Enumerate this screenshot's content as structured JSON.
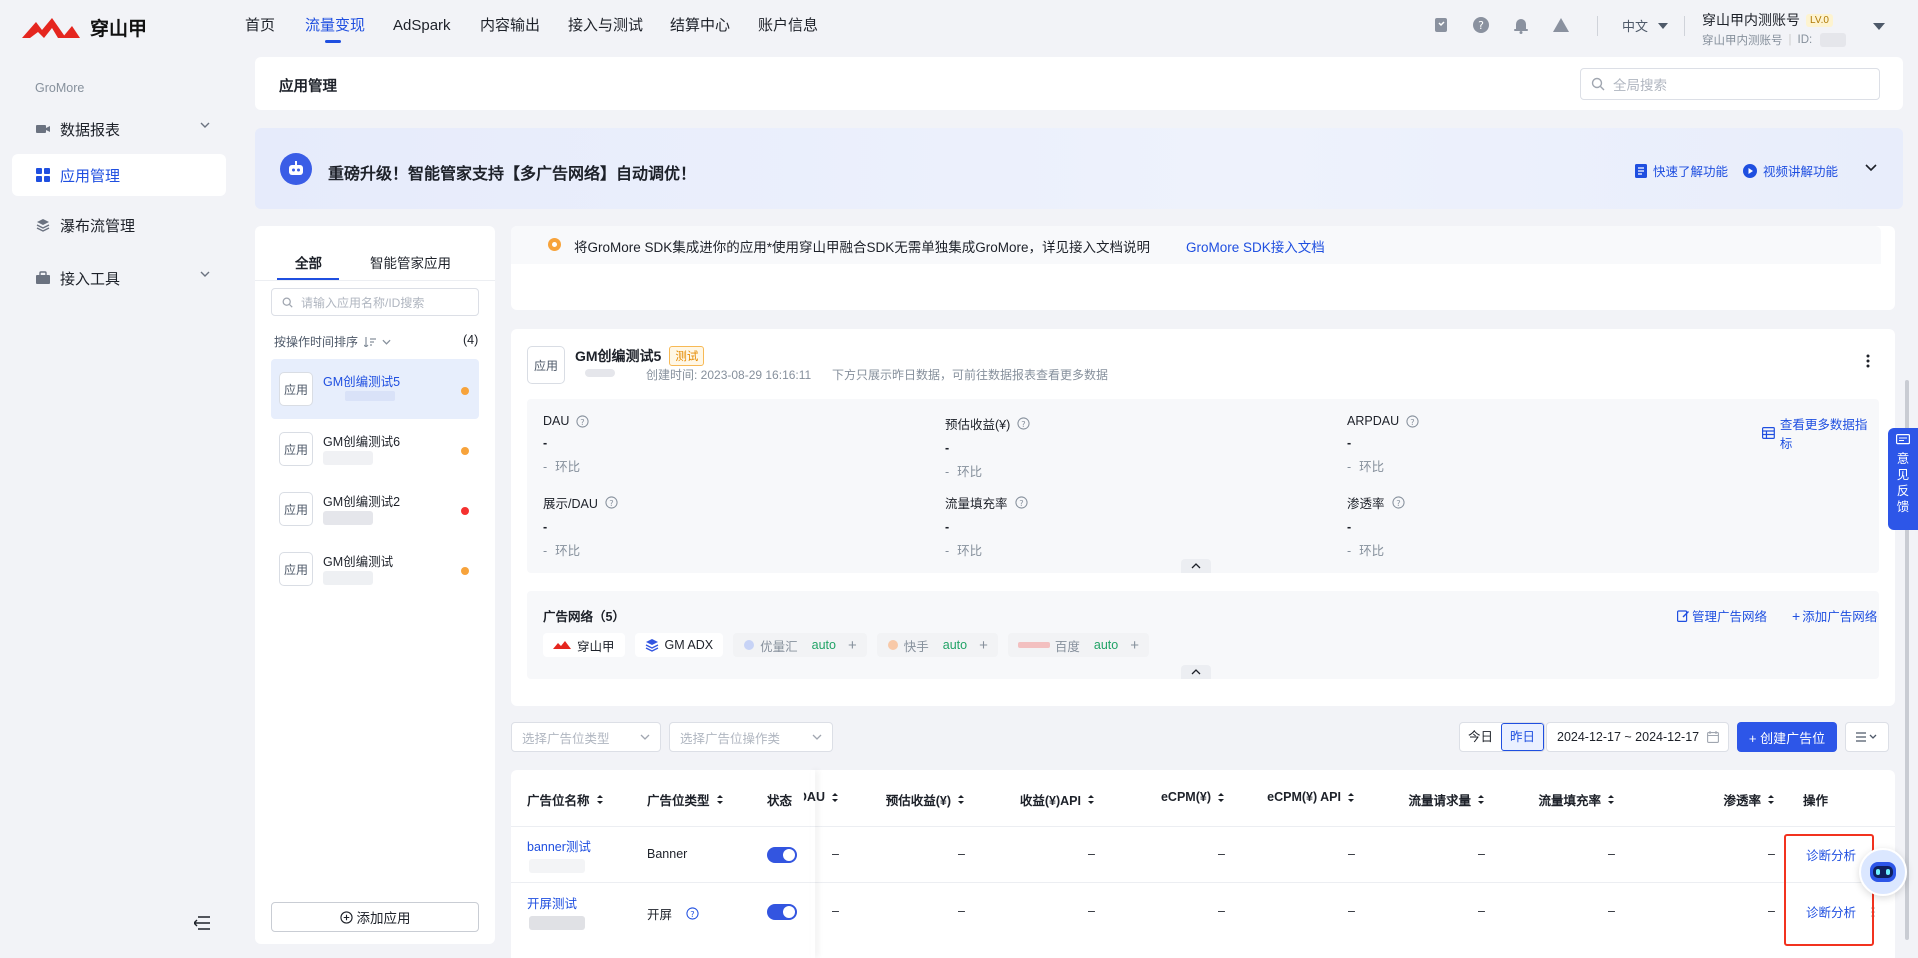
{
  "brand": {
    "logo_text": "穿山甲",
    "color": "#e5261f"
  },
  "nav": {
    "items": [
      "首页",
      "流量变现",
      "AdSpark",
      "内容输出",
      "接入与测试",
      "结算中心",
      "账户信息"
    ],
    "active_index": 1
  },
  "account": {
    "language": "中文",
    "name": "穿山甲内测账号",
    "level": "LV.0",
    "sub": "穿山甲内测账号",
    "id_label": "ID:"
  },
  "sidebar": {
    "section": "GroMore",
    "items": [
      {
        "label": "数据报表",
        "icon": "video-icon"
      },
      {
        "label": "应用管理",
        "icon": "grid-icon"
      },
      {
        "label": "瀑布流管理",
        "icon": "layers-icon"
      },
      {
        "label": "接入工具",
        "icon": "toolbox-icon"
      }
    ],
    "active_index": 1
  },
  "header": {
    "title": "应用管理",
    "search_placeholder": "全局搜索"
  },
  "banner": {
    "text": "重磅升级！智能管家支持【多广告网络】自动调优！",
    "link1": "快速了解功能",
    "link2": "视频讲解功能"
  },
  "app_list": {
    "tabs": [
      "全部",
      "智能管家应用"
    ],
    "search_placeholder": "请输入应用名称/ID搜索",
    "sort_label": "按操作时间排序",
    "count": "(4)",
    "icon_label": "应用",
    "items": [
      {
        "name": "GM创编测试5",
        "status_color": "#f7a33b"
      },
      {
        "name": "GM创编测试6",
        "status_color": "#f7a33b"
      },
      {
        "name": "GM创编测试2",
        "status_color": "#f5312f"
      },
      {
        "name": "GM创编测试",
        "status_color": "#f7a33b"
      }
    ],
    "add_label": "添加应用"
  },
  "notice": {
    "text": "将GroMore SDK集成进你的应用*使用穿山甲融合SDK无需单独集成GroMore，详见接入文档说明",
    "link": "GroMore SDK接入文档"
  },
  "app_detail": {
    "icon_label": "应用",
    "name": "GM创编测试5",
    "tag": "测试",
    "created": "创建时间: 2023-08-29 16:16:11",
    "hint": "下方只展示昨日数据，可前往数据报表查看更多数据",
    "more_metrics": "查看更多数据指标",
    "metrics": [
      {
        "label": "DAU",
        "value": "-",
        "change": "-",
        "change_label": "环比"
      },
      {
        "label": "预估收益(¥)",
        "value": "-",
        "change": "-",
        "change_label": "环比"
      },
      {
        "label": "ARPDAU",
        "value": "-",
        "change": "-",
        "change_label": "环比"
      },
      {
        "label": "展示/DAU",
        "value": "-",
        "change": "-",
        "change_label": "环比"
      },
      {
        "label": "流量填充率",
        "value": "-",
        "change": "-",
        "change_label": "环比"
      },
      {
        "label": "渗透率",
        "value": "-",
        "change": "-",
        "change_label": "环比"
      }
    ]
  },
  "ad_networks": {
    "title": "广告网络（5）",
    "manage": "管理广告网络",
    "add": "添加广告网络",
    "chips": [
      {
        "name": "穿山甲",
        "auto": ""
      },
      {
        "name": "GM ADX",
        "auto": ""
      },
      {
        "name": "优量汇",
        "auto": "auto"
      },
      {
        "name": "快手",
        "auto": "auto"
      },
      {
        "name": "百度",
        "auto": "auto"
      }
    ]
  },
  "filters": {
    "type_placeholder": "选择广告位类型",
    "op_placeholder": "选择广告位操作类",
    "today": "今日",
    "yesterday": "昨日",
    "date_range": "2024-12-17 ~ 2024-12-17",
    "create": "+ 创建广告位"
  },
  "table": {
    "headers": [
      "广告位名称",
      "广告位类型",
      "状态",
      "DAU",
      "预估收益(¥)",
      "收益(¥)API",
      "eCPM(¥)",
      "eCPM(¥) API",
      "流量请求量",
      "流量填充率",
      "渗透率",
      "操作"
    ],
    "rows": [
      {
        "name": "banner测试",
        "type": "Banner",
        "cells": [
          "–",
          "–",
          "–",
          "–",
          "–",
          "–",
          "–",
          "–"
        ],
        "action": "诊断分析"
      },
      {
        "name": "开屏测试",
        "type": "开屏",
        "cells": [
          "–",
          "–",
          "–",
          "–",
          "–",
          "–",
          "–",
          "–"
        ],
        "action": "诊断分析"
      }
    ]
  },
  "feedback": {
    "label": "意见反馈"
  },
  "accent_color": "#1f4fe0"
}
